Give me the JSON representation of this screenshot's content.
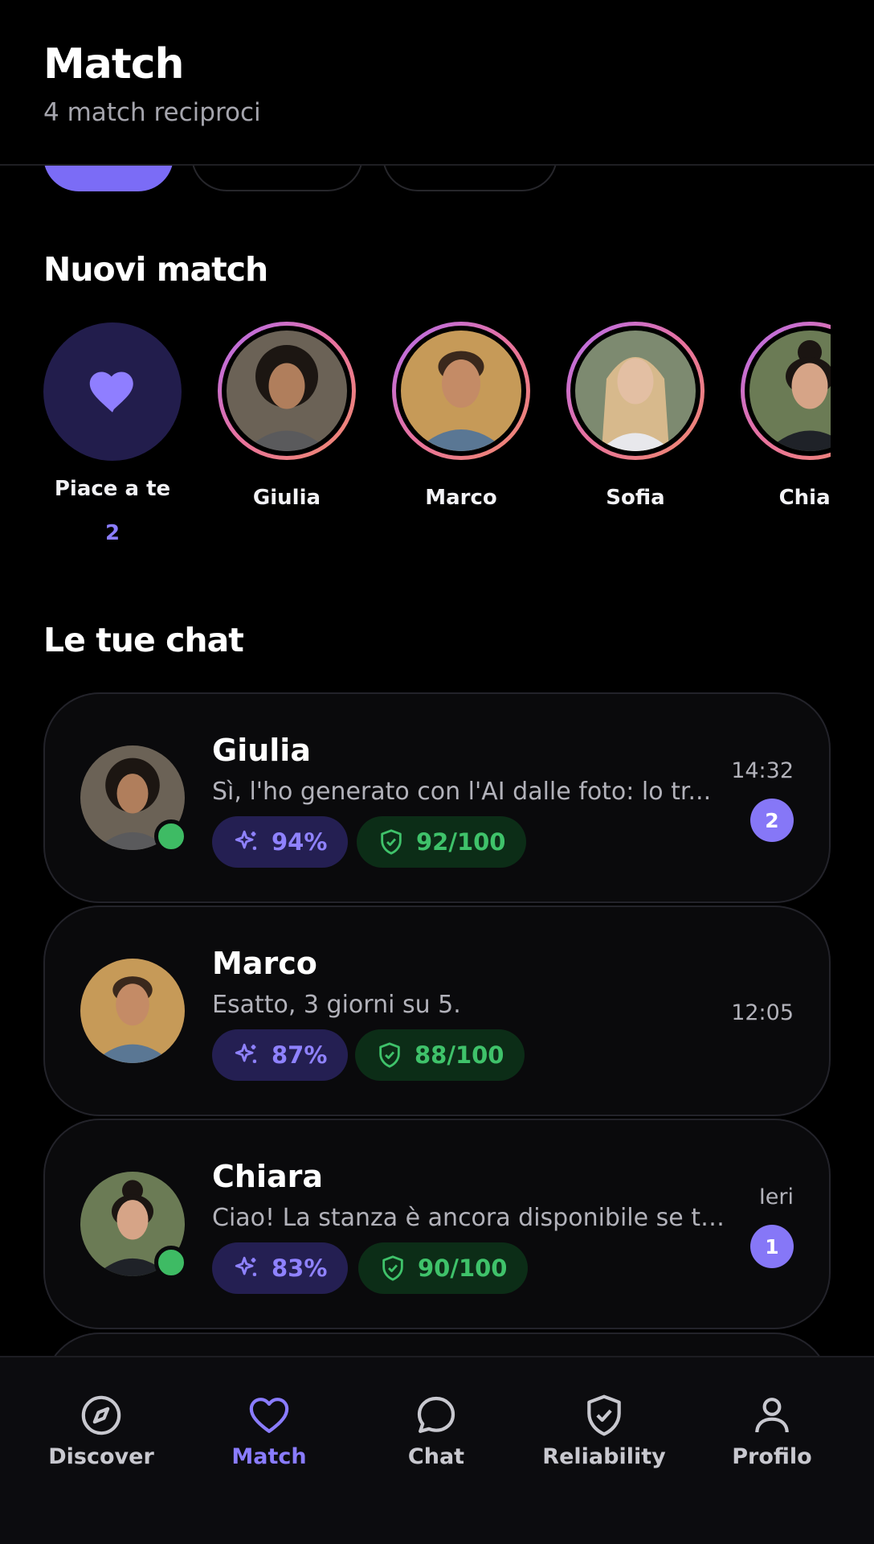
{
  "header": {
    "title": "Match",
    "subtitle": "4 match reciproci"
  },
  "new_matches": {
    "section_title": "Nuovi match",
    "likes": {
      "label": "Piace a te",
      "count": "2",
      "icon": "heart-icon"
    },
    "people": [
      {
        "name": "Giulia"
      },
      {
        "name": "Marco"
      },
      {
        "name": "Sofia"
      },
      {
        "name": "Chiar"
      }
    ]
  },
  "chats": {
    "section_title": "Le tue chat",
    "items": [
      {
        "name": "Giulia",
        "message": "Sì, l'ho generato con l'AI dalle foto: lo tr...",
        "time": "14:32",
        "unread": "2",
        "online": true,
        "ai_score": "94%",
        "reliability": "92/100"
      },
      {
        "name": "Marco",
        "message": "Esatto, 3 giorni su 5.",
        "time": "12:05",
        "unread": "",
        "online": false,
        "ai_score": "87%",
        "reliability": "88/100"
      },
      {
        "name": "Chiara",
        "message": "Ciao! La stanza è ancora disponibile se ti ...",
        "time": "Ieri",
        "unread": "1",
        "online": true,
        "ai_score": "83%",
        "reliability": "90/100"
      }
    ]
  },
  "nav": {
    "items": [
      {
        "label": "Discover",
        "icon": "compass-icon"
      },
      {
        "label": "Match",
        "icon": "heart-icon"
      },
      {
        "label": "Chat",
        "icon": "chat-bubble-icon"
      },
      {
        "label": "Reliability",
        "icon": "shield-check-icon"
      },
      {
        "label": "Profilo",
        "icon": "user-icon"
      }
    ],
    "active": "Match"
  },
  "colors": {
    "accent": "#8677f7",
    "online": "#3ebb64",
    "ai_chip_bg": "#241f52",
    "reliability_chip_bg": "#0c2d17"
  }
}
